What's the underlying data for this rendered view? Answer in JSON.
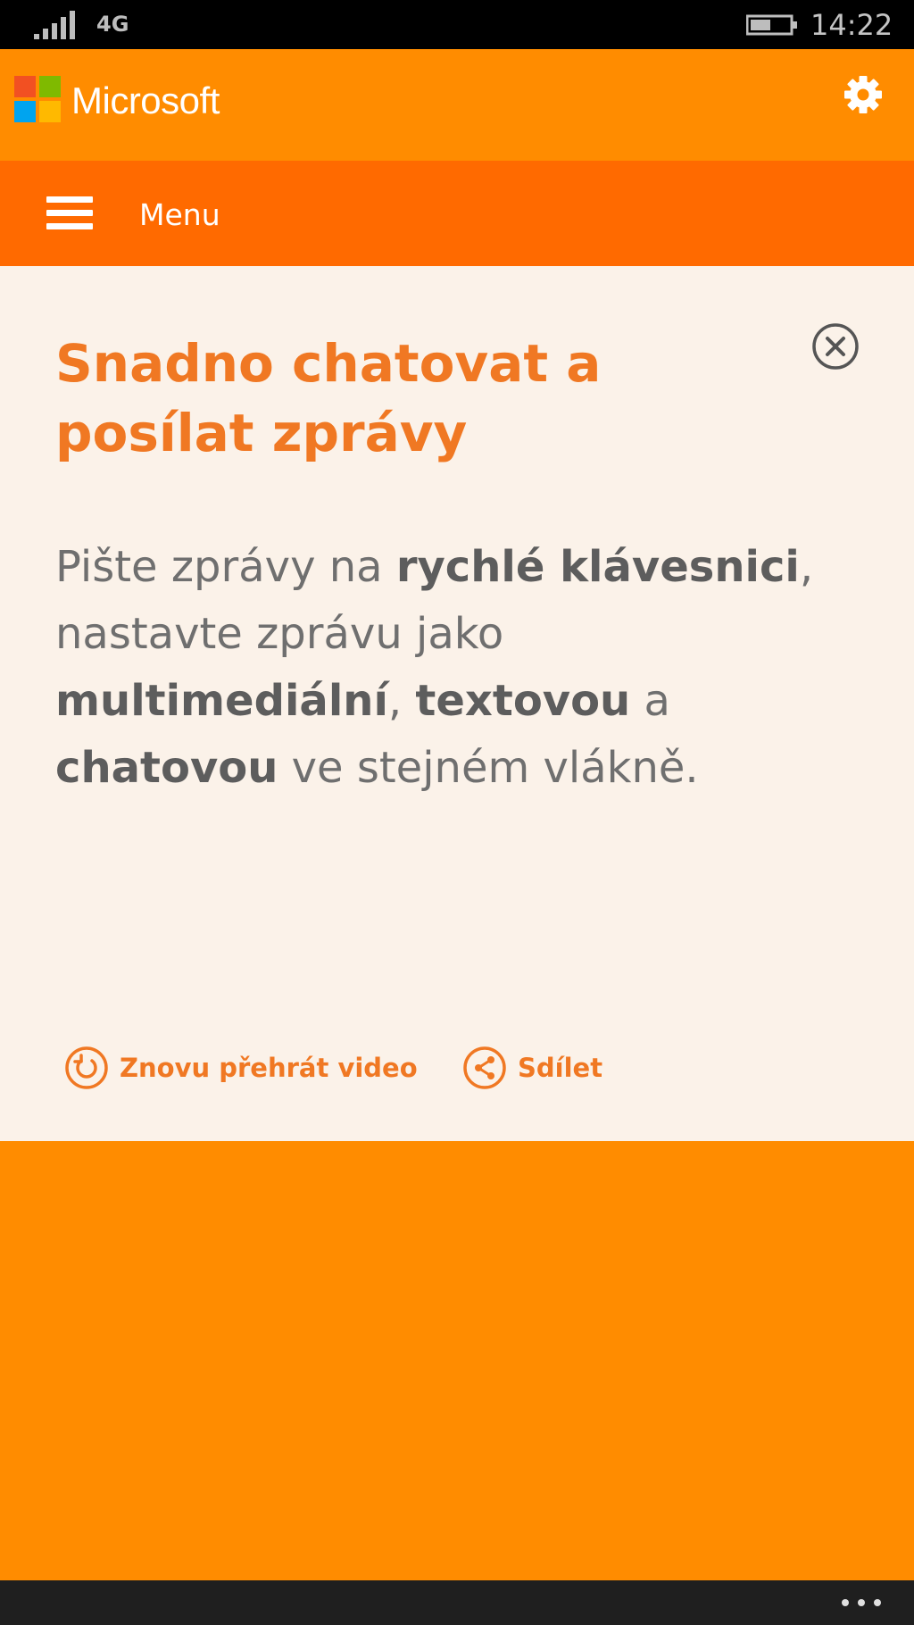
{
  "status_bar": {
    "network": "4G",
    "time": "14:22"
  },
  "header": {
    "brand": "Microsoft",
    "icons": {
      "logo": "microsoft-logo-icon",
      "settings": "gear-icon"
    },
    "colors": {
      "logo_red": "#f25022",
      "logo_green": "#7fba00",
      "logo_blue": "#00a4ef",
      "logo_yellow": "#ffb900"
    }
  },
  "menu": {
    "label": "Menu",
    "icon": "hamburger-icon"
  },
  "card": {
    "title": "Snadno chatovat a posílat zprávy",
    "body": {
      "t1": "Pište zprávy na ",
      "b1": "rychlé klávesnici",
      "t2": ", nastavte zprávu jako ",
      "b2": "multimediální",
      "t3": ", ",
      "b3": "textovou",
      "t4": " a ",
      "b4": "chatovou",
      "t5": " ve stejném vlákně."
    },
    "close_icon": "close-circle-icon",
    "actions": {
      "replay_label": "Znovu přehrát video",
      "replay_icon": "replay-icon",
      "share_label": "Sdílet",
      "share_icon": "share-icon"
    }
  },
  "bottom_bar": {
    "more_icon": "more-dots-icon"
  },
  "colors": {
    "accent_orange": "#ff8c00",
    "menu_orange": "#ff6a00",
    "card_background": "#fbf2e9",
    "title_orange": "#f07823",
    "body_gray": "#6f6f6f"
  }
}
